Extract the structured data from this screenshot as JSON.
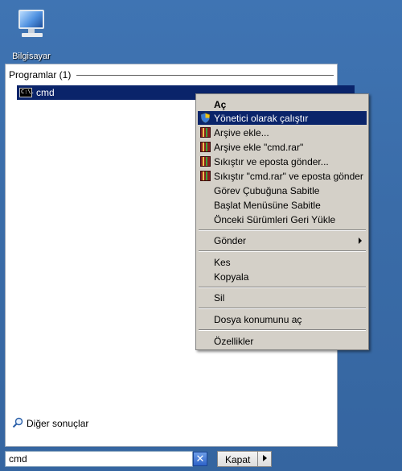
{
  "desktop": {
    "icon_label": "Bilgisayar"
  },
  "start_menu": {
    "group_title": "Programlar (1)",
    "result_item": {
      "label": "cmd",
      "icon_text": "C:\\."
    },
    "more_results": "Diğer sonuçlar",
    "search": {
      "value": "cmd"
    },
    "clear_symbol": "✕",
    "shutdown_label": "Kapat"
  },
  "context_menu": {
    "items": {
      "open": "Aç",
      "run_as_admin": "Yönetici olarak çalıştır",
      "add_archive": "Arşive ekle...",
      "add_to_rar": "Arşive ekle \"cmd.rar\"",
      "compress_email": "Sıkıştır ve eposta gönder...",
      "compress_rar_email": "Sıkıştır \"cmd.rar\" ve eposta gönder",
      "pin_taskbar": "Görev Çubuğuna Sabitle",
      "pin_start": "Başlat Menüsüne Sabitle",
      "restore_versions": "Önceki Sürümleri Geri Yükle",
      "send_to": "Gönder",
      "cut": "Kes",
      "copy": "Kopyala",
      "delete": "Sil",
      "open_location": "Dosya konumunu aç",
      "properties": "Özellikler"
    }
  },
  "colors": {
    "highlight": "#0a246a",
    "menu_bg": "#d4d0c8",
    "desktop": "#3c6fad"
  }
}
